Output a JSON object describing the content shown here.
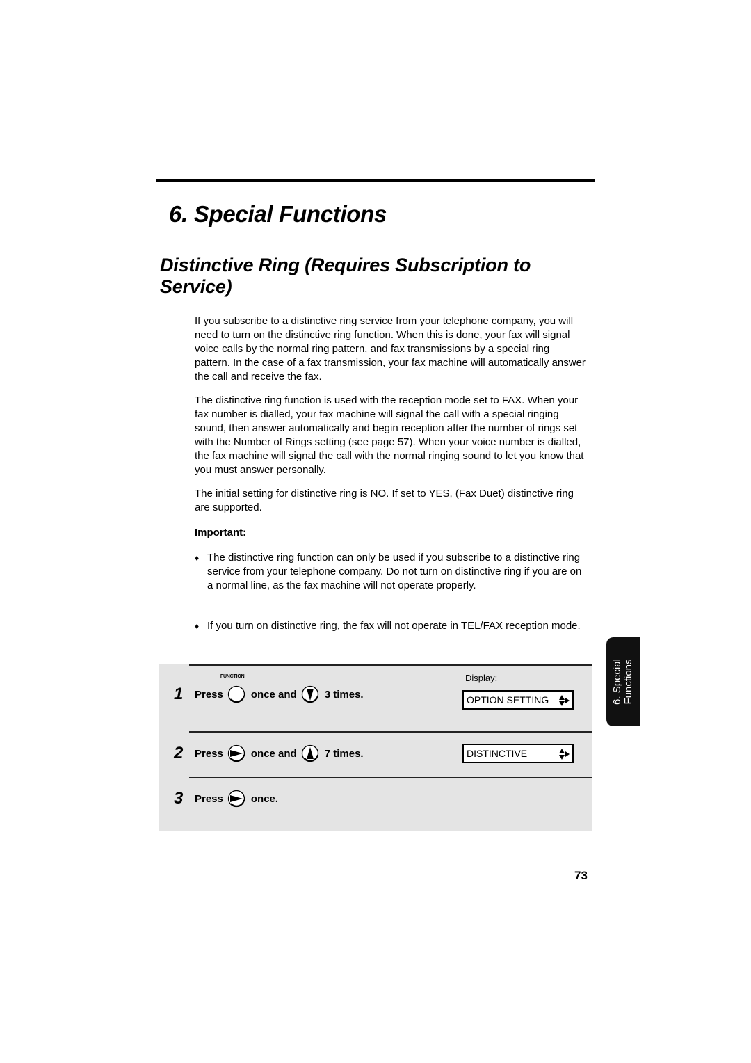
{
  "chapter": {
    "title": "6.  Special Functions"
  },
  "section": {
    "title": "Distinctive Ring (Requires Subscription to Service)"
  },
  "paragraphs": [
    "If you subscribe to a distinctive ring service from your telephone company, you will need to turn on the distinctive ring function. When this is done, your fax will signal voice calls by the normal ring pattern, and fax transmissions by a special ring pattern. In the case of a fax transmission, your fax machine will automatically answer the call and receive the fax.",
    "The distinctive ring function is used with the reception mode set to FAX. When your fax number is dialled, your fax machine will signal the call with a special ringing sound, then answer automatically and begin reception after the number of rings set with the Number of Rings setting (see page 57). When your voice number is dialled, the fax machine will signal the call with the normal ringing sound to let you know that you must answer personally.",
    "The initial setting for distinctive ring is NO. If set to YES,  (Fax Duet) distinctive ring are supported."
  ],
  "important": {
    "label": "Important:",
    "bullet_glyph": "♦",
    "items": [
      "The distinctive ring function can only be used if you subscribe to a distinctive ring service from your telephone company. Do not turn on distinctive ring if you are on a normal line, as the fax machine will not operate properly.",
      "If you turn on distinctive ring, the fax will not operate in TEL/FAX reception mode."
    ]
  },
  "steps": {
    "display_label": "Display:",
    "items": [
      {
        "number": "1",
        "press": "Press",
        "key1_caption": "FUNCTION",
        "key1_icon": "function-key-icon",
        "middle": "once and",
        "key2_icon": "down-arrow-key-icon",
        "end": "3 times.",
        "display": "OPTION SETTING"
      },
      {
        "number": "2",
        "press": "Press",
        "key1_icon": "right-arrow-key-icon",
        "middle": "once and",
        "key2_icon": "up-arrow-key-icon",
        "end": "7 times.",
        "display": "DISTINCTIVE"
      },
      {
        "number": "3",
        "press": "Press",
        "key1_icon": "right-arrow-key-icon",
        "end": "once."
      }
    ]
  },
  "side_tab": {
    "line1": "6. Special",
    "line2": "Functions"
  },
  "page_number": "73"
}
